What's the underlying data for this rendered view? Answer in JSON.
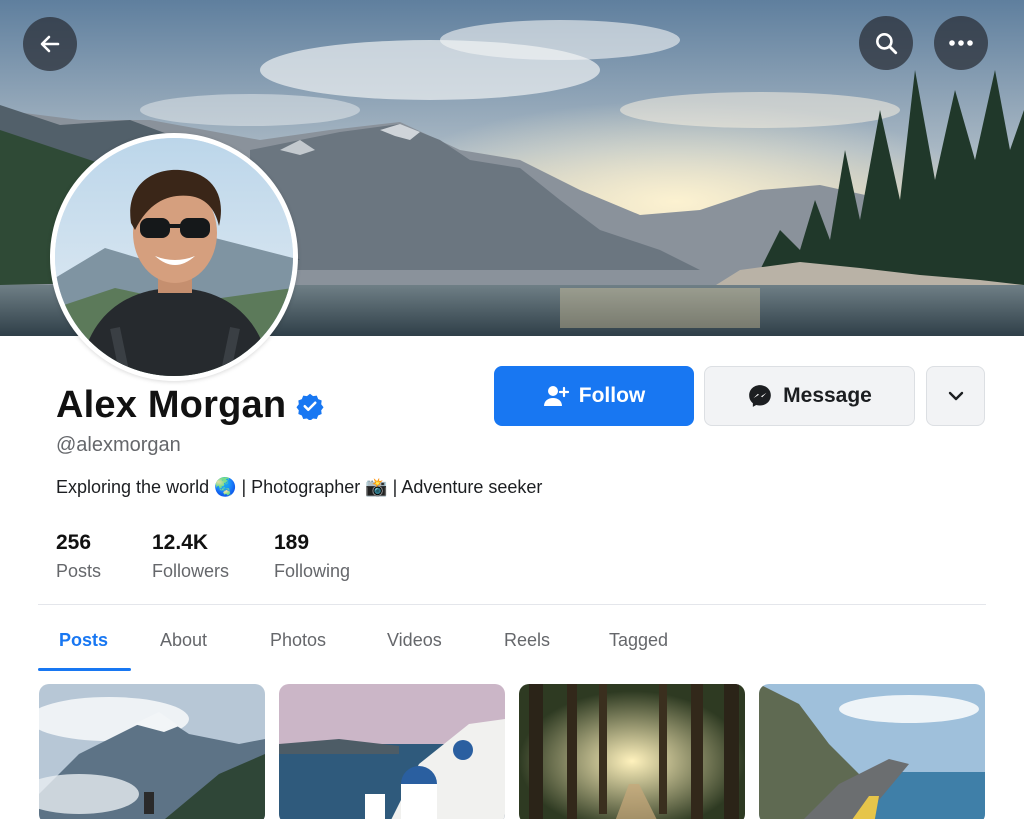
{
  "header": {
    "back_icon": "arrow-left-icon",
    "search_icon": "search-icon",
    "more_icon": "more-horizontal-icon"
  },
  "profile": {
    "name": "Alex Morgan",
    "verified_icon": "verified-badge-icon",
    "handle": "@alexmorgan",
    "bio": "Exploring the world 🌏 | Photographer 📸 | Adventure seeker"
  },
  "actions": {
    "follow_label": "Follow",
    "follow_icon": "user-plus-icon",
    "message_label": "Message",
    "message_icon": "messenger-icon",
    "more_icon": "chevron-down-icon"
  },
  "stats": [
    {
      "value": "256",
      "label": "Posts"
    },
    {
      "value": "12.4K",
      "label": "Followers"
    },
    {
      "value": "189",
      "label": "Following"
    }
  ],
  "tabs": [
    {
      "label": "Posts",
      "active": true
    },
    {
      "label": "About",
      "active": false
    },
    {
      "label": "Photos",
      "active": false
    },
    {
      "label": "Videos",
      "active": false
    },
    {
      "label": "Reels",
      "active": false
    },
    {
      "label": "Tagged",
      "active": false
    }
  ],
  "colors": {
    "accent": "#1877f2",
    "muted_text": "#65676b"
  }
}
